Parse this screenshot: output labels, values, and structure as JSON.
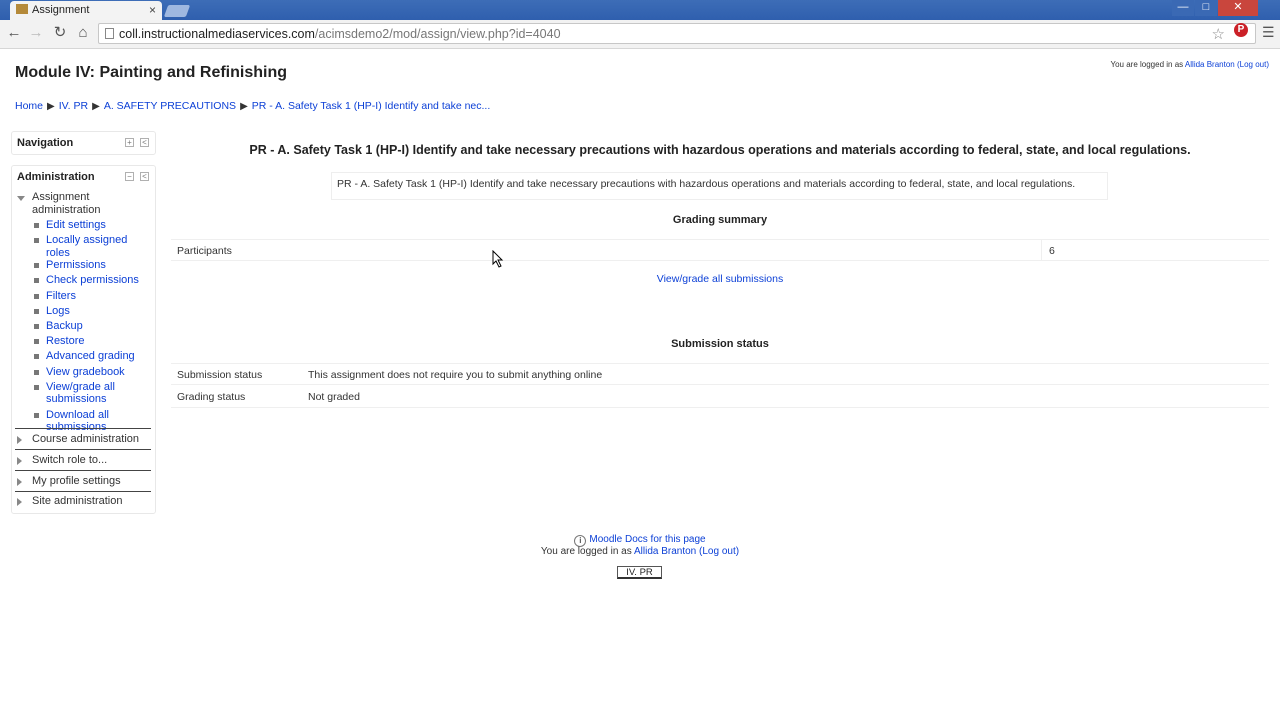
{
  "browser": {
    "tab_title": "Assignment",
    "tab_close": "×",
    "url_host": "coll.instructionalmediaservices.com",
    "url_path": "/acimsdemo2/mod/assign/view.php?id=4040",
    "star": "☆",
    "window_controls": {
      "minimize": "—",
      "maximize": "□",
      "close": "✕"
    }
  },
  "header": {
    "page_title": "Module IV: Painting and Refinishing",
    "login_prefix": "You are logged in as",
    "login_user": "Allida Branton",
    "logout_label": "(Log out)"
  },
  "breadcrumb": {
    "items": [
      "Home",
      "IV. PR",
      "A. SAFETY PRECAUTIONS",
      "PR - A. Safety Task 1 (HP-I) Identify and take nec..."
    ],
    "separator": "▶"
  },
  "sidebar": {
    "navigation_title": "Navigation",
    "administration_title": "Administration",
    "assignment_admin_label": "Assignment administration",
    "assignment_admin_items": [
      "Edit settings",
      "Locally assigned roles",
      "Permissions",
      "Check permissions",
      "Filters",
      "Logs",
      "Backup",
      "Restore",
      "Advanced grading",
      "View gradebook",
      "View/grade all submissions",
      "Download all submissions"
    ],
    "other_sections": [
      "Course administration",
      "Switch role to...",
      "My profile settings",
      "Site administration"
    ]
  },
  "main": {
    "title": "PR - A. Safety Task 1 (HP-I) Identify and take necessary precautions with hazardous operations and materials according to federal, state, and local regulations.",
    "intro": "PR - A. Safety Task 1 (HP-I) Identify and take necessary precautions with hazardous operations and materials according to federal, state, and local regulations.",
    "grading_summary_title": "Grading summary",
    "participants_label": "Participants",
    "participants_value": "6",
    "view_grade_link": "View/grade all submissions",
    "submission_status_title": "Submission status",
    "submission_rows": [
      {
        "label": "Submission status",
        "value": "This assignment does not require you to submit anything online"
      },
      {
        "label": "Grading status",
        "value": "Not graded"
      }
    ]
  },
  "footer": {
    "docs_link": "Moodle Docs for this page",
    "login_prefix": "You are logged in as",
    "login_user": "Allida Branton",
    "logout_label": "(Log out)",
    "course_button": "IV. PR"
  }
}
